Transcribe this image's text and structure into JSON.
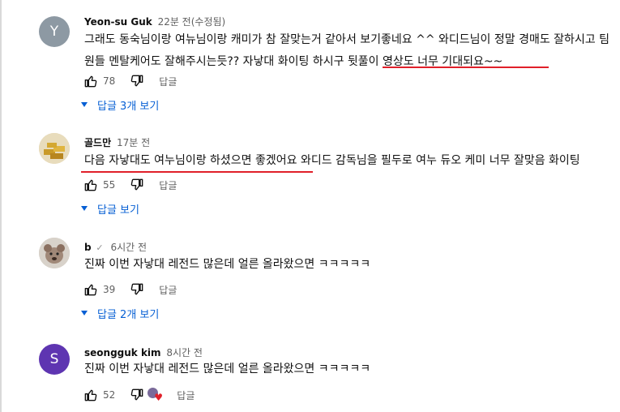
{
  "comments": [
    {
      "author": "Yeon-su Guk",
      "time": "22분 전(수정됨)",
      "avatar_letter": "Y",
      "avatar_color": "#8d99a3",
      "text": "그래도 동숙님이랑 여뉴님이랑 캐미가 참 잘맞는거 같아서 보기좋네요 ^^ 와디드님이 정말 경매도 잘하시고 팀원들 멘탈케어도 잘해주시는듯?? 자낳대 화이팅 하시구 뒷풀이 영상도 너무 기대되요~~",
      "likes": "78",
      "reply_label": "답글",
      "replies_label": "답글 3개 보기"
    },
    {
      "author": "골드만",
      "time": "17분 전",
      "text": "다음 자낳대도 여누님이랑 하셨으면 좋겠어요 와디드 감독님을 필두로 여누 듀오 케미 너무 잘맞음 화이팅",
      "likes": "55",
      "reply_label": "답글",
      "replies_label": "답글 보기"
    },
    {
      "author": "b",
      "time": "6시간 전",
      "text": "진짜 이번 자낳대 레전드 많은데 얼른 올라왔으면 ㅋㅋㅋㅋㅋ",
      "likes": "39",
      "reply_label": "답글",
      "replies_label": "답글 2개 보기"
    },
    {
      "author": "seongguk kim",
      "time": "8시간 전",
      "avatar_letter": "S",
      "avatar_color": "#5e35b1",
      "text": "진짜 이번 자낳대 레전드 많은데 얼른 올라왔으면 ㅋㅋㅋㅋㅋ",
      "likes": "52",
      "reply_label": "답글"
    }
  ],
  "colors": {
    "accent_link": "#065fd4",
    "underline_annotation": "#e0202a",
    "meta_text": "#606060"
  },
  "icons": [
    "thumbs-up-icon",
    "thumbs-down-icon",
    "chevron-down-icon",
    "checkmark-icon",
    "creator-heart-icon"
  ]
}
